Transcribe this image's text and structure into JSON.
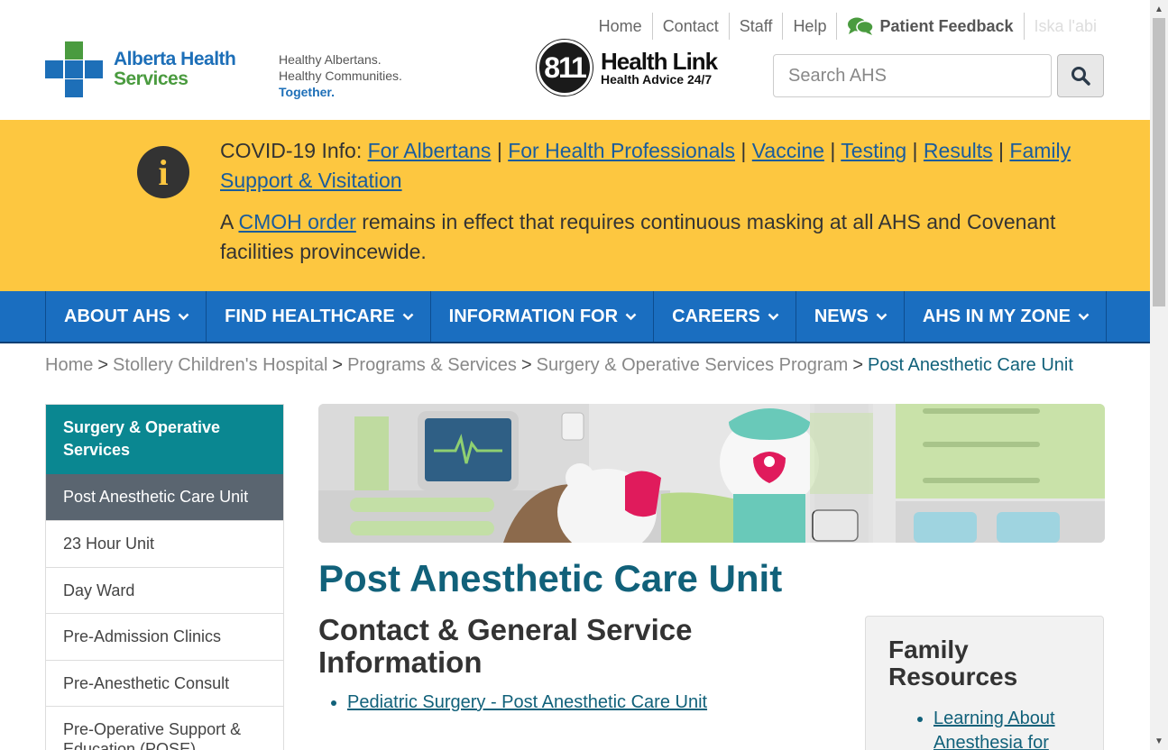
{
  "utility_nav": {
    "home": "Home",
    "contact": "Contact",
    "staff": "Staff",
    "help": "Help",
    "feedback": "Patient Feedback",
    "language": "Iska l'abi"
  },
  "logo": {
    "line1": "Alberta Health",
    "line2": "Services"
  },
  "tagline": {
    "line1": "Healthy Albertans.",
    "line2": "Healthy Communities.",
    "line3": "Together."
  },
  "healthlink": {
    "number": "811",
    "title": "Health Link",
    "subtitle": "Health Advice 24/7"
  },
  "search": {
    "placeholder": "Search AHS"
  },
  "alert": {
    "prefix": "COVID-19 Info:",
    "links": [
      "For Albertans",
      "For Health Professionals",
      "Vaccine",
      "Testing",
      "Results",
      "Family Support & Visitation"
    ],
    "separator": "|",
    "line2_before": "A",
    "line2_link": "CMOH order",
    "line2_after": "remains in effect that requires continuous masking at all AHS and Covenant facilities provincewide."
  },
  "main_nav": [
    "ABOUT AHS",
    "FIND HEALTHCARE",
    "INFORMATION FOR",
    "CAREERS",
    "NEWS",
    "AHS IN MY ZONE"
  ],
  "breadcrumb": {
    "items": [
      "Home",
      "Stollery Children's Hospital",
      "Programs & Services",
      "Surgery & Operative Services Program"
    ],
    "current": "Post Anesthetic Care Unit",
    "separator": ">"
  },
  "sidebar": {
    "heading": "Surgery & Operative Services",
    "active": "Post Anesthetic Care Unit",
    "items": [
      "23 Hour Unit",
      "Day Ward",
      "Pre-Admission Clinics",
      "Pre-Anesthetic Consult",
      "Pre-Operative Support & Education (POSE)"
    ]
  },
  "main": {
    "title": "Post Anesthetic Care Unit",
    "section_title": "Contact & General Service Information",
    "contact_links": [
      "Pediatric Surgery - Post Anesthetic Care Unit"
    ]
  },
  "family_resources": {
    "title": "Family Resources",
    "links": [
      "Learning About Anesthesia for Children"
    ]
  },
  "colors": {
    "alert_bg": "#fdc740",
    "nav_bg": "#1a6ec0",
    "sidebar_head": "#0a8791",
    "title": "#11617a"
  }
}
